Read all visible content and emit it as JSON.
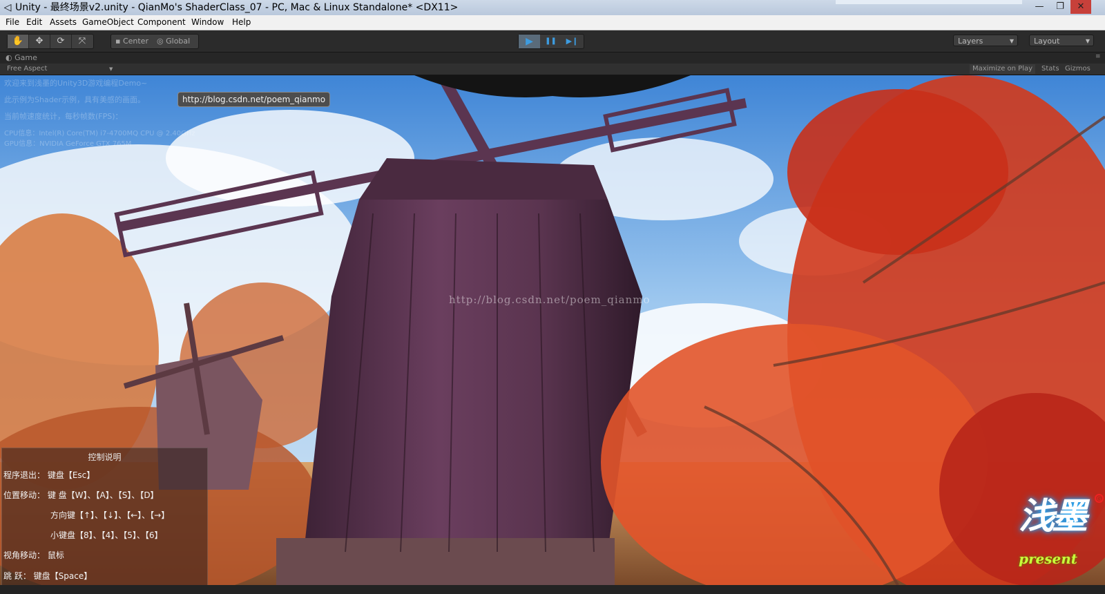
{
  "window": {
    "title": "Unity - 最终场景v2.unity - QianMo's ShaderClass_07 - PC, Mac & Linux Standalone* <DX11>",
    "minimize_glyph": "—",
    "maximize_glyph": "❐",
    "close_glyph": "✕",
    "app_icon": "unity-icon"
  },
  "menu": [
    "File",
    "Edit",
    "Assets",
    "GameObject",
    "Component",
    "Window",
    "Help"
  ],
  "toolbar": {
    "transform_tools": [
      {
        "icon": "hand-icon",
        "glyph": "✋"
      },
      {
        "icon": "move-icon",
        "glyph": "✥"
      },
      {
        "icon": "rotate-icon",
        "glyph": "⟳"
      },
      {
        "icon": "scale-icon",
        "glyph": "⤧"
      }
    ],
    "pivot_label": "Center",
    "space_label": "Global",
    "play_glyph": "▶",
    "pause_glyph": "❚❚",
    "step_glyph": "▶❙",
    "layers_label": "Layers",
    "layout_label": "Layout"
  },
  "game_view": {
    "tab_label": "Game",
    "aspect_label": "Free Aspect",
    "maximize_label": "Maximize on Play",
    "stats_label": "Stats",
    "gizmos_label": "Gizmos"
  },
  "overlay": {
    "hud_lines": [
      "欢迎来到浅墨的Unity3D游戏编程Demo~",
      "此示例为Shader示例，具有美感的画面。",
      "当前帧速度统计，每秒帧数(FPS)：",
      "CPU信息：Intel(R) Core(TM) i7-4700MQ CPU @ 2.40GHz",
      "GPU信息：NVIDIA GeForce GTX 765M"
    ],
    "url_badge": "http://blog.csdn.net/poem_qianmo",
    "watermark": "http://blog.csdn.net/poem_qianmo"
  },
  "controls": {
    "title": "控制说明",
    "lines": [
      "程序退出：  键盘【Esc】",
      "位置移动：  键    盘【W】、【A】、【S】、【D】",
      "方向键【↑】、【↓】、【←】、【→】",
      "小键盘【8】、【4】、【5】、【6】",
      "视角移动：  鼠标",
      "跳      跃：  键盘【Space】"
    ]
  },
  "logo": {
    "text": "浅墨",
    "sub": "present",
    "mark": "G"
  },
  "colors": {
    "sky": "#9fc8ee",
    "mill_wood": "#5b3550",
    "foliage": "#e0401e",
    "play_accent": "#3d9ce0"
  }
}
